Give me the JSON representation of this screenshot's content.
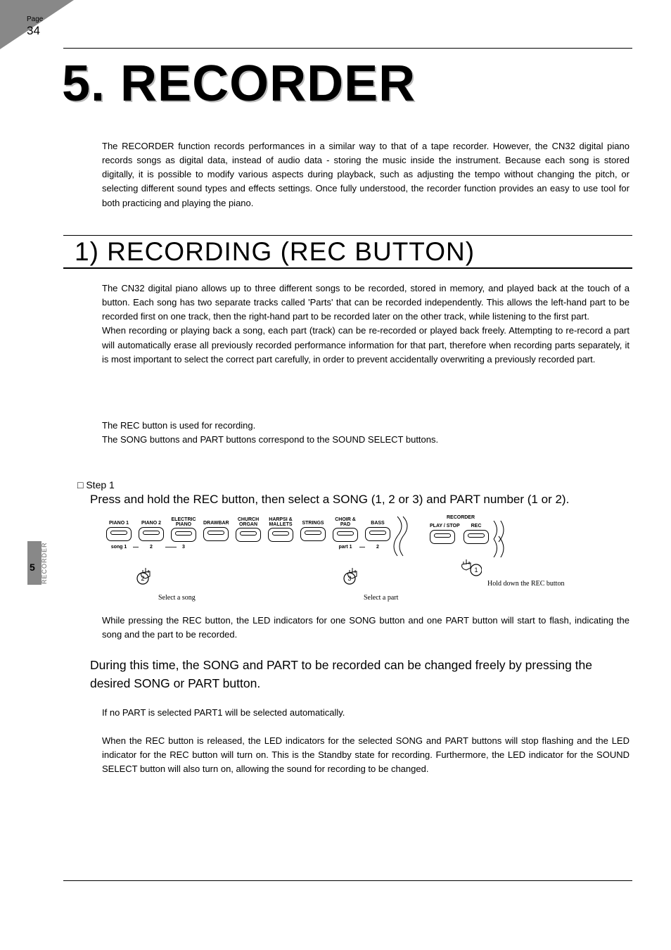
{
  "page": {
    "label": "Page",
    "number": "34"
  },
  "side": {
    "chapter": "5",
    "label": "RECORDER"
  },
  "chapter_title": "5. RECORDER",
  "intro": "The RECORDER function records performances in a similar way to that of a tape recorder. However, the CN32 digital piano records songs as digital data, instead of audio data - storing the music inside the instrument. Because each song is stored digitally, it is possible to modify various aspects during playback, such as adjusting the tempo without changing the pitch, or selecting different sound types and effects settings. Once fully understood, the recorder function provides an easy to use tool for both practicing and playing the piano.",
  "section_title": "1) RECORDING (REC BUTTON)",
  "body1": "The CN32 digital piano allows up to three different songs to be recorded, stored in memory, and played back at the touch of a button.  Each song has two separate tracks called 'Parts' that can be recorded independently.  This allows the left-hand part to be recorded first on one track, then the right-hand part to be recorded later on the other track, while listening to the first part.\nWhen recording or playing back a song, each part (track) can be re-recorded or played back freely.  Attempting to re-record a part will automatically erase all previously recorded performance information for that part, therefore when recording parts separately, it is most important to select the correct part carefully, in order to prevent accidentally overwriting a previously recorded part.",
  "body2": "The REC button is used for recording.\nThe SONG buttons and PART buttons correspond to the SOUND SELECT buttons.",
  "step": {
    "marker": "□ Step 1",
    "text": "Press and hold the REC button, then select a SONG (1, 2 or 3) and PART number (1 or 2)."
  },
  "diagram": {
    "labels": [
      "PIANO 1",
      "PIANO 2",
      "ELECTRIC PIANO",
      "DRAWBAR",
      "CHURCH ORGAN",
      "HARPSI & MALLETS",
      "STRINGS",
      "CHOIR & PAD",
      "BASS"
    ],
    "song_labels": [
      "song 1",
      "2",
      "3"
    ],
    "part_labels": [
      "part 1",
      "2"
    ],
    "recorder_label": "RECORDER",
    "play_label": "PLAY / STOP",
    "rec_label": "REC",
    "action_song": "Select a song",
    "action_part": "Select a part",
    "action_rec": "Hold down the REC button",
    "circles": [
      "1",
      "2",
      "3"
    ]
  },
  "note1": "While pressing the REC button, the LED indicators for one SONG button and one PART button will start to flash, indicating the song and the part to be recorded.",
  "note2": "During this time, the SONG and PART to be recorded can be changed freely by pressing the desired SONG or PART button.",
  "note3": "If no PART is selected PART1 will be selected automatically.",
  "note4": "When the REC button is released, the LED indicators for the selected SONG and PART buttons will stop flashing and the LED indicator for the REC button will turn on. This is the Standby state for recording. Furthermore, the LED indicator for the SOUND SELECT button will also turn on, allowing the sound for recording to be changed."
}
